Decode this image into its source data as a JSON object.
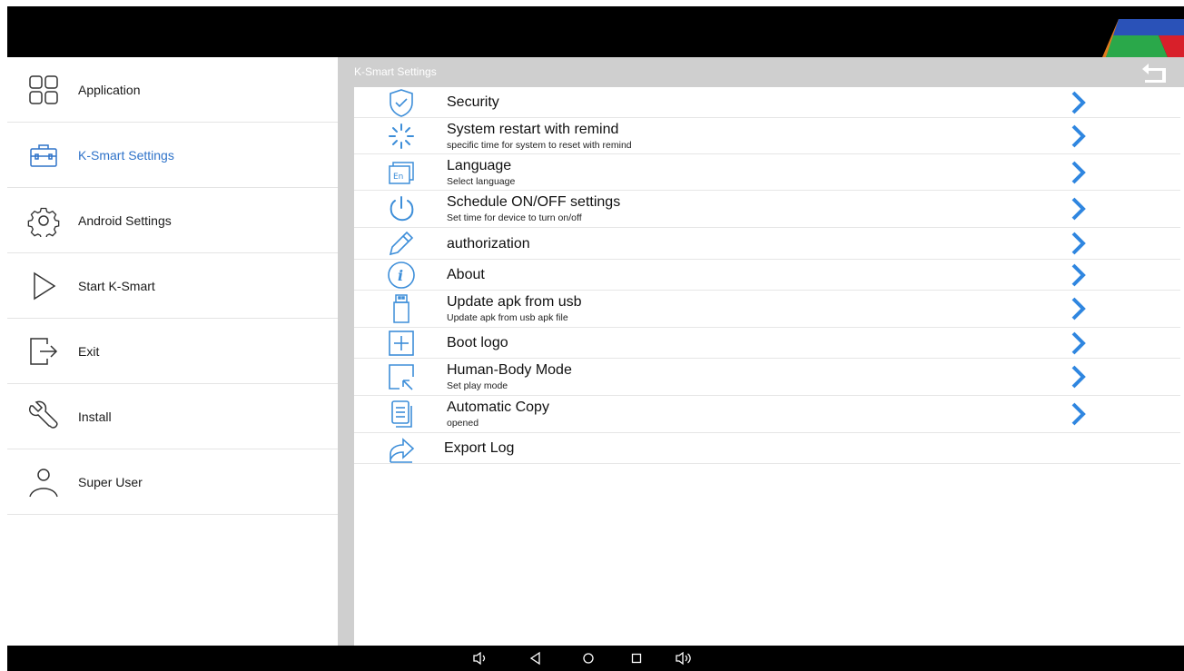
{
  "sidebar": {
    "items": [
      {
        "label": "Application",
        "icon": "grid-icon",
        "active": false
      },
      {
        "label": "K-Smart Settings",
        "icon": "toolbox-icon",
        "active": true
      },
      {
        "label": "Android Settings",
        "icon": "gear-icon",
        "active": false
      },
      {
        "label": "Start K-Smart",
        "icon": "play-icon",
        "active": false
      },
      {
        "label": "Exit",
        "icon": "exit-icon",
        "active": false
      },
      {
        "label": "Install",
        "icon": "wrench-icon",
        "active": false
      },
      {
        "label": "Super User",
        "icon": "user-icon",
        "active": false
      }
    ]
  },
  "header": {
    "title": "K-Smart Settings",
    "back_icon": "back-arrow-icon"
  },
  "settings": [
    {
      "title": "Security",
      "subtitle": "",
      "icon": "shield-check-icon",
      "chevron": true
    },
    {
      "title": "System restart with remind",
      "subtitle": "specific time for system to reset with remind",
      "icon": "restart-spinner-icon",
      "chevron": true
    },
    {
      "title": "Language",
      "subtitle": "Select language",
      "icon": "language-en-icon",
      "chevron": true
    },
    {
      "title": "Schedule ON/OFF settings",
      "subtitle": "Set time for device to turn on/off",
      "icon": "power-icon",
      "chevron": true
    },
    {
      "title": "authorization",
      "subtitle": "",
      "icon": "pencil-icon",
      "chevron": true
    },
    {
      "title": "About",
      "subtitle": "",
      "icon": "info-icon",
      "chevron": true
    },
    {
      "title": "Update apk from usb",
      "subtitle": "Update apk from usb apk file",
      "icon": "usb-drive-icon",
      "chevron": true
    },
    {
      "title": "Boot logo",
      "subtitle": "",
      "icon": "plus-box-icon",
      "chevron": true
    },
    {
      "title": "Human-Body Mode",
      "subtitle": "Set play mode",
      "icon": "cursor-box-icon",
      "chevron": true
    },
    {
      "title": "Automatic Copy",
      "subtitle": "opened",
      "icon": "document-copy-icon",
      "chevron": true
    },
    {
      "title": "Export Log",
      "subtitle": "",
      "icon": "share-export-icon",
      "chevron": false
    }
  ],
  "navbar": [
    "volume-down-icon",
    "back-icon",
    "home-icon",
    "recents-icon",
    "volume-up-icon"
  ],
  "colors": {
    "accent": "#2f73c9",
    "icon_blue": "#3d8ed9",
    "chevron_blue": "#2f86e0",
    "header_gray": "#cfcfcf"
  }
}
